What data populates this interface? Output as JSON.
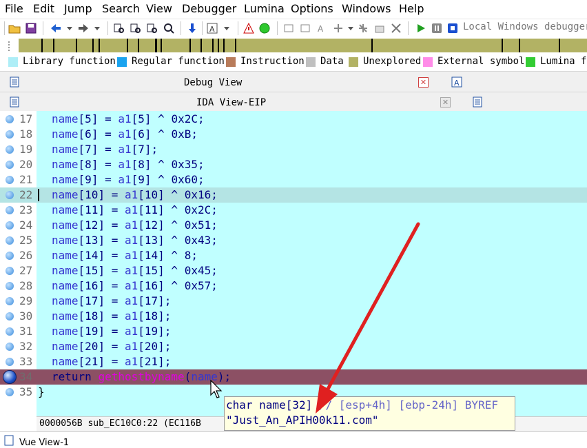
{
  "menu": [
    "File",
    "Edit",
    "Jump",
    "Search",
    "View",
    "Debugger",
    "Lumina",
    "Options",
    "Windows",
    "Help"
  ],
  "toolbar": {
    "icons": [
      "open-folder-icon",
      "save-icon",
      "back-icon",
      "forward-icon",
      "binary-search-icon",
      "text-search-icon",
      "search-next-icon",
      "down-arrow-icon",
      "ascii-icon",
      "graph-icon",
      "green-circle-icon",
      "instruction-icon",
      "data-icon",
      "string-icon",
      "struct-icon",
      "enum-icon",
      "edit-icon",
      "delete-icon",
      "run-icon",
      "pause-icon",
      "stop-icon"
    ],
    "debugger": "Local Windows debugger"
  },
  "nav_band": {
    "color": "#b2b264",
    "marks": [
      4,
      6,
      10,
      13,
      14,
      19,
      21,
      24,
      25,
      30,
      32,
      34,
      35,
      36,
      38,
      62,
      85,
      88,
      95
    ]
  },
  "legend": [
    {
      "label": "Library function",
      "color": "#aeeef7"
    },
    {
      "label": "Regular function",
      "color": "#1aa3ef"
    },
    {
      "label": "Instruction",
      "color": "#b87b5a"
    },
    {
      "label": "Data",
      "color": "#c0c0c0"
    },
    {
      "label": "Unexplored",
      "color": "#b2b264"
    },
    {
      "label": "External symbol",
      "color": "#ff8ce8"
    },
    {
      "label": "Lumina fu",
      "color": "#33cc33"
    }
  ],
  "tabs": {
    "debug_view": "Debug View",
    "ida_view": "IDA View-EIP"
  },
  "code": {
    "lines": [
      {
        "num": "17",
        "var": "name",
        "idx": "5",
        "src": "a1",
        "sidx": "5",
        "op": " ^ ",
        "val": "0x2C"
      },
      {
        "num": "18",
        "var": "name",
        "idx": "6",
        "src": "a1",
        "sidx": "6",
        "op": " ^ ",
        "val": "0xB"
      },
      {
        "num": "19",
        "var": "name",
        "idx": "7",
        "src": "a1",
        "sidx": "7",
        "op": "",
        "val": ""
      },
      {
        "num": "20",
        "var": "name",
        "idx": "8",
        "src": "a1",
        "sidx": "8",
        "op": " ^ ",
        "val": "0x35"
      },
      {
        "num": "21",
        "var": "name",
        "idx": "9",
        "src": "a1",
        "sidx": "9",
        "op": " ^ ",
        "val": "0x60"
      },
      {
        "num": "22",
        "var": "name",
        "idx": "10",
        "src": "a1",
        "sidx": "10",
        "op": " ^ ",
        "val": "0x16"
      },
      {
        "num": "23",
        "var": "name",
        "idx": "11",
        "src": "a1",
        "sidx": "11",
        "op": " ^ ",
        "val": "0x2C"
      },
      {
        "num": "24",
        "var": "name",
        "idx": "12",
        "src": "a1",
        "sidx": "12",
        "op": " ^ ",
        "val": "0x51"
      },
      {
        "num": "25",
        "var": "name",
        "idx": "13",
        "src": "a1",
        "sidx": "13",
        "op": " ^ ",
        "val": "0x43"
      },
      {
        "num": "26",
        "var": "name",
        "idx": "14",
        "src": "a1",
        "sidx": "14",
        "op": " ^ ",
        "val": "8"
      },
      {
        "num": "27",
        "var": "name",
        "idx": "15",
        "src": "a1",
        "sidx": "15",
        "op": " ^ ",
        "val": "0x45"
      },
      {
        "num": "28",
        "var": "name",
        "idx": "16",
        "src": "a1",
        "sidx": "16",
        "op": " ^ ",
        "val": "0x57"
      },
      {
        "num": "29",
        "var": "name",
        "idx": "17",
        "src": "a1",
        "sidx": "17",
        "op": "",
        "val": ""
      },
      {
        "num": "30",
        "var": "name",
        "idx": "18",
        "src": "a1",
        "sidx": "18",
        "op": "",
        "val": ""
      },
      {
        "num": "31",
        "var": "name",
        "idx": "19",
        "src": "a1",
        "sidx": "19",
        "op": "",
        "val": ""
      },
      {
        "num": "32",
        "var": "name",
        "idx": "20",
        "src": "a1",
        "sidx": "20",
        "op": "",
        "val": ""
      },
      {
        "num": "33",
        "var": "name",
        "idx": "21",
        "src": "a1",
        "sidx": "21",
        "op": "",
        "val": ""
      }
    ],
    "return_line": {
      "num": "34",
      "keyword": "return",
      "func": "gethostbyname",
      "arg": "name"
    },
    "close_line": {
      "num": "35",
      "text": "}"
    }
  },
  "status": "0000056B sub_EC10C0:22 (EC116B",
  "bottom": "Vue View-1",
  "tooltip": {
    "decl_type": "char name[32]",
    "comment": "// [esp+4h] [ebp-24h] BYREF",
    "value": "\"Just_An_APIH00k11.com\""
  }
}
